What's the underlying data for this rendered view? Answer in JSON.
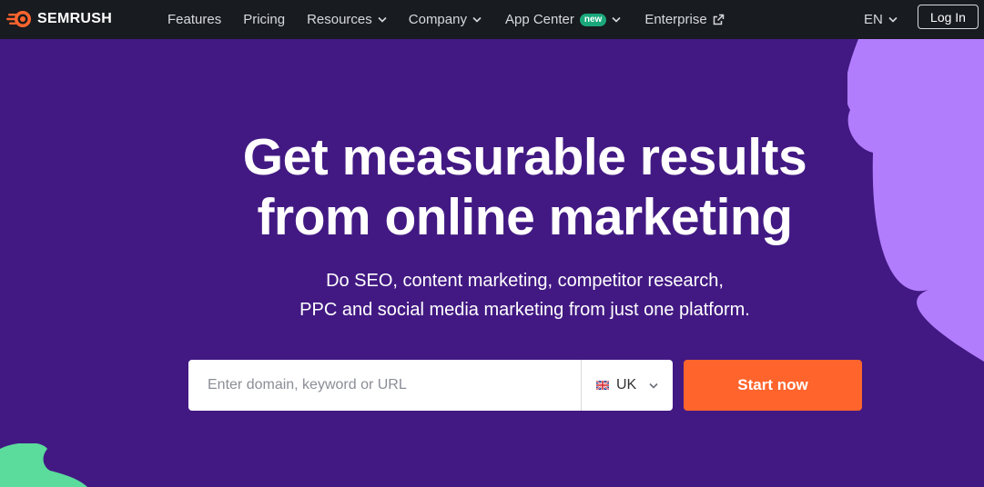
{
  "brand": {
    "name": "SEMRUSH",
    "accent": "#ff642d"
  },
  "nav": {
    "items": [
      {
        "label": "Features",
        "dropdown": false
      },
      {
        "label": "Pricing",
        "dropdown": false
      },
      {
        "label": "Resources",
        "dropdown": true
      },
      {
        "label": "Company",
        "dropdown": true
      },
      {
        "label": "App Center",
        "badge": "new",
        "dropdown": true
      },
      {
        "label": "Enterprise",
        "icon": "external-link-icon"
      }
    ],
    "language": "EN",
    "login_label": "Log In"
  },
  "hero": {
    "title_line1": "Get measurable results",
    "title_line2": "from online marketing",
    "subtitle_line1": "Do SEO, content marketing, competitor research,",
    "subtitle_line2": "PPC and social media marketing from just one platform.",
    "search_placeholder": "Enter domain, keyword or URL",
    "database": {
      "flag_icon": "uk-flag-icon",
      "label": "UK"
    },
    "cta_label": "Start now"
  },
  "colors": {
    "background": "#421983",
    "nav_background": "#181b1f",
    "decor_purple": "#b27dfd",
    "decor_green": "#5bdb9c",
    "badge_green": "#1aa87b"
  }
}
